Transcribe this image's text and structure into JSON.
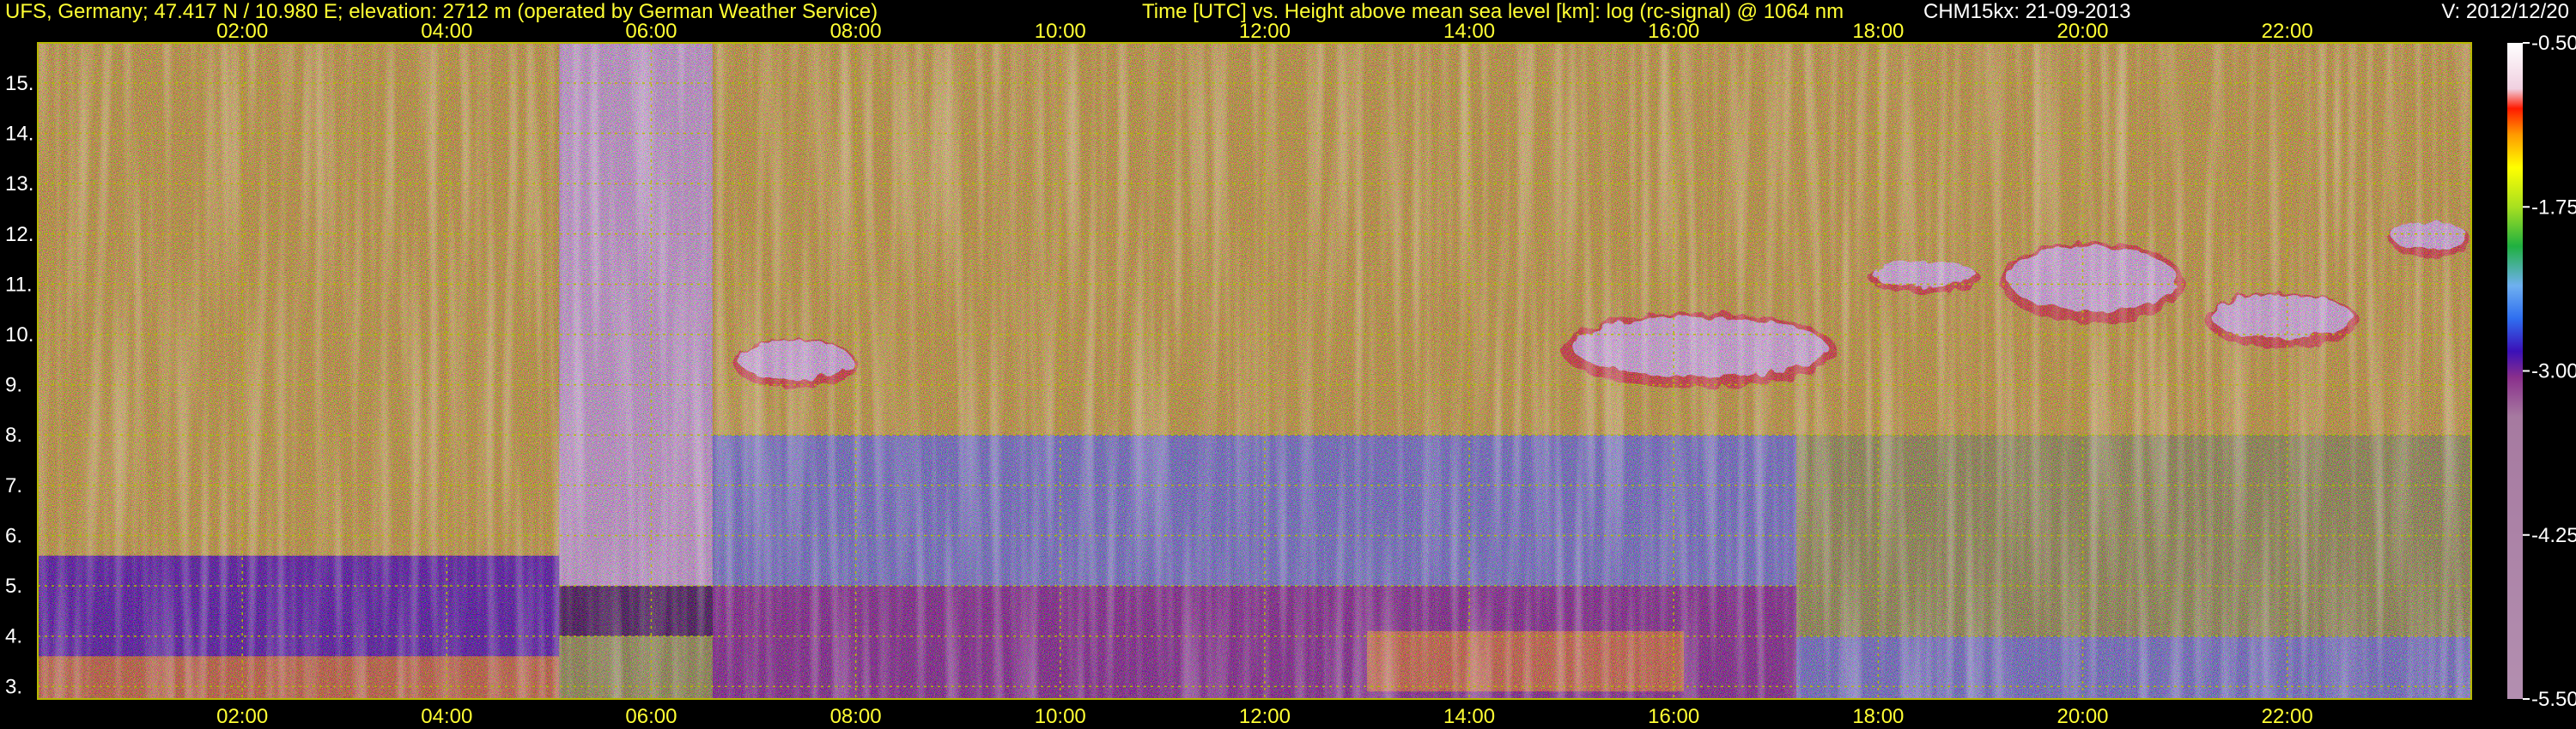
{
  "header": {
    "station": "UFS, Germany; 47.417 N / 10.980 E; elevation: 2712 m  (operated by German Weather Service)",
    "axis_title": "Time [UTC] vs. Height above mean sea level [km]: log (rc-signal) @ 1064 nm",
    "instrument": "CHM15kx: 21-09-2013",
    "version": "V: 2012/12/20"
  },
  "colors": {
    "background": "#000000",
    "header_text": "#ffff33",
    "grid": "#b8b800",
    "cloud": "#ffffff"
  },
  "chart_data": {
    "type": "heatmap",
    "title": "Time [UTC] vs. Height above mean sea level [km]: log (rc-signal) @ 1064 nm",
    "x_unit": "hours UTC",
    "y_unit": "km",
    "xlim": [
      0.0,
      23.8
    ],
    "ylim": [
      2.75,
      15.8
    ],
    "grid": true,
    "x_ticks": [
      {
        "value": 2,
        "label": "02:00"
      },
      {
        "value": 4,
        "label": "04:00"
      },
      {
        "value": 6,
        "label": "06:00"
      },
      {
        "value": 8,
        "label": "08:00"
      },
      {
        "value": 10,
        "label": "10:00"
      },
      {
        "value": 12,
        "label": "12:00"
      },
      {
        "value": 14,
        "label": "14:00"
      },
      {
        "value": 16,
        "label": "16:00"
      },
      {
        "value": 18,
        "label": "18:00"
      },
      {
        "value": 20,
        "label": "20:00"
      },
      {
        "value": 22,
        "label": "22:00"
      }
    ],
    "y_ticks": [
      {
        "value": 3,
        "label": "3."
      },
      {
        "value": 4,
        "label": "4."
      },
      {
        "value": 5,
        "label": "5."
      },
      {
        "value": 6,
        "label": "6."
      },
      {
        "value": 7,
        "label": "7."
      },
      {
        "value": 8,
        "label": "8."
      },
      {
        "value": 9,
        "label": "9."
      },
      {
        "value": 10,
        "label": "10."
      },
      {
        "value": 11,
        "label": "11."
      },
      {
        "value": 12,
        "label": "12."
      },
      {
        "value": 13,
        "label": "13."
      },
      {
        "value": 14,
        "label": "14."
      },
      {
        "value": 15,
        "label": "15."
      }
    ],
    "colorbar": {
      "range": [
        -5.5,
        -0.5
      ],
      "ticks": [
        {
          "value": -0.5,
          "label": "-0.50"
        },
        {
          "value": -1.75,
          "label": "-1.75"
        },
        {
          "value": -3.0,
          "label": "-3.00"
        },
        {
          "value": -4.25,
          "label": "-4.25"
        },
        {
          "value": -5.5,
          "label": "-5.50"
        }
      ],
      "stops": [
        {
          "value": -5.5,
          "color": "#b38fb0"
        },
        {
          "value": -3.35,
          "color": "#a67aa0"
        },
        {
          "value": -3.05,
          "color": "#8a2f8c"
        },
        {
          "value": -2.85,
          "color": "#3b10b8"
        },
        {
          "value": -2.6,
          "color": "#2f6ff0"
        },
        {
          "value": -2.35,
          "color": "#6fb0f0"
        },
        {
          "value": -2.05,
          "color": "#1fb040"
        },
        {
          "value": -1.75,
          "color": "#a8e020"
        },
        {
          "value": -1.45,
          "color": "#ffff00"
        },
        {
          "value": -1.2,
          "color": "#ff9a00"
        },
        {
          "value": -1.0,
          "color": "#ff1a00"
        },
        {
          "value": -0.85,
          "color": "#f0d0e0"
        },
        {
          "value": -0.5,
          "color": "#ffffff"
        }
      ]
    },
    "signal_regions": [
      {
        "name": "noise-upper-night",
        "x": [
          0.0,
          5.1
        ],
        "y": [
          5.6,
          15.8
        ],
        "value": -1.5
      },
      {
        "name": "noise-upper-morning-bright",
        "x": [
          5.1,
          6.6
        ],
        "y": [
          5.0,
          15.8
        ],
        "value": -0.8
      },
      {
        "name": "noise-upper-day",
        "x": [
          6.6,
          23.8
        ],
        "y": [
          8.0,
          15.8
        ],
        "value": -1.6
      },
      {
        "name": "noise-mid-day",
        "x": [
          6.6,
          17.2
        ],
        "y": [
          5.0,
          8.0
        ],
        "value": -2.4
      },
      {
        "name": "noise-mid-evening",
        "x": [
          17.2,
          23.8
        ],
        "y": [
          4.0,
          8.0
        ],
        "value": -2.0
      },
      {
        "name": "low-night",
        "x": [
          0.0,
          5.1
        ],
        "y": [
          3.6,
          5.6
        ],
        "value": -2.9
      },
      {
        "name": "low-day",
        "x": [
          6.6,
          17.2
        ],
        "y": [
          2.75,
          5.0
        ],
        "value": -3.1
      },
      {
        "name": "low-evening",
        "x": [
          17.2,
          23.8
        ],
        "y": [
          2.75,
          4.0
        ],
        "value": -2.5
      },
      {
        "name": "boundary-layer-night",
        "x": [
          0.0,
          5.1
        ],
        "y": [
          2.75,
          3.6
        ],
        "value": -1.4
      },
      {
        "name": "boundary-layer-morning",
        "x": [
          5.1,
          6.6
        ],
        "y": [
          2.75,
          4.0
        ],
        "value": -1.8
      },
      {
        "name": "convective-plumes-midday",
        "x": [
          13.0,
          16.1
        ],
        "y": [
          2.9,
          4.1
        ],
        "value": -1.2
      }
    ],
    "cloud_layers": [
      {
        "name": "cloud-morning",
        "x": [
          6.8,
          8.0
        ],
        "y": [
          9.0,
          10.0
        ],
        "value": -0.6
      },
      {
        "name": "cloud-midday",
        "x": [
          14.9,
          17.6
        ],
        "y": [
          9.0,
          10.5
        ],
        "value": -0.6
      },
      {
        "name": "cloud-evening-a",
        "x": [
          17.9,
          19.0
        ],
        "y": [
          10.9,
          11.5
        ],
        "value": -0.5
      },
      {
        "name": "cloud-evening-b",
        "x": [
          19.2,
          21.0
        ],
        "y": [
          10.3,
          11.9
        ],
        "value": -0.5
      },
      {
        "name": "cloud-evening-c",
        "x": [
          21.2,
          22.7
        ],
        "y": [
          9.8,
          10.9
        ],
        "value": -0.5
      },
      {
        "name": "cloud-late",
        "x": [
          23.0,
          23.8
        ],
        "y": [
          11.6,
          12.3
        ],
        "value": -0.5
      }
    ]
  }
}
